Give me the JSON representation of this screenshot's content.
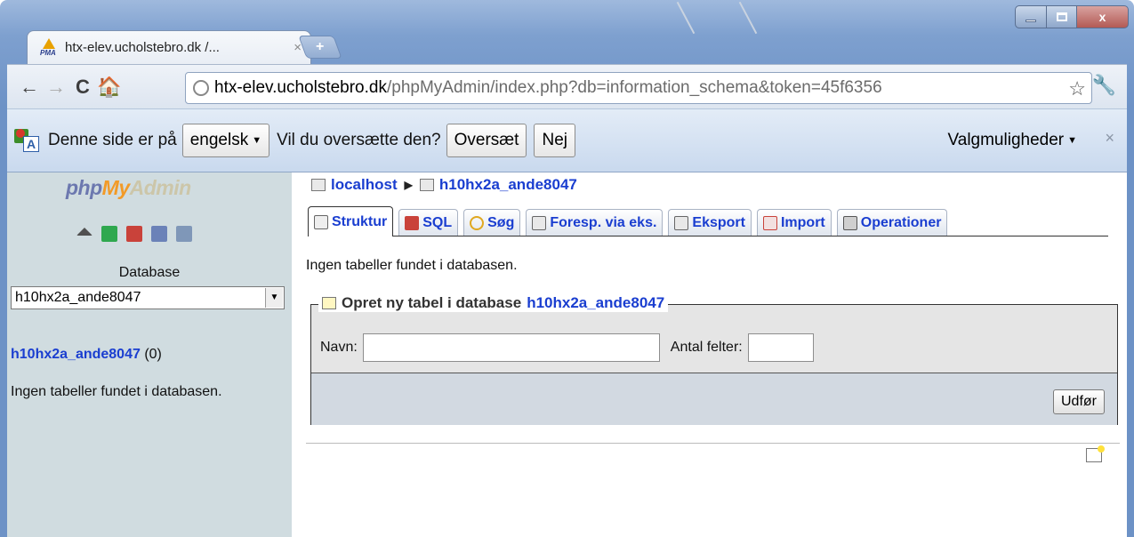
{
  "browser": {
    "tab_title": "htx-elev.ucholstebro.dk /...",
    "tab_close": "×",
    "new_tab": "+",
    "win_close": "x",
    "nav": {
      "back": "←",
      "forward": "→",
      "reload": "C",
      "home": "🏠"
    },
    "url_host": "htx-elev.ucholstebro.dk",
    "url_rest": "/phpMyAdmin/index.php?db=information_schema&token=45f6356",
    "bookmark": "☆",
    "menu": "🔧"
  },
  "translate_bar": {
    "prefix": "Denne side er på",
    "language": "engelsk",
    "question": "Vil du oversætte den?",
    "translate_button": "Oversæt",
    "no_button": "Nej",
    "options": "Valgmuligheder",
    "close": "×"
  },
  "sidebar": {
    "logo_php": "php",
    "logo_my": "My",
    "logo_admin": "Admin",
    "db_label": "Database",
    "db_selected": "h10hx2a_ande8047",
    "db_link": "h10hx2a_ande8047",
    "db_count": "(0)",
    "message": "Ingen tabeller fundet i databasen."
  },
  "main": {
    "breadcrumb_server": "localhost",
    "breadcrumb_db": "h10hx2a_ande8047",
    "tabs": [
      {
        "label": "Struktur"
      },
      {
        "label": "SQL"
      },
      {
        "label": "Søg"
      },
      {
        "label": "Foresp. via eks."
      },
      {
        "label": "Eksport"
      },
      {
        "label": "Import"
      },
      {
        "label": "Operationer"
      }
    ],
    "message": "Ingen tabeller fundet i databasen.",
    "create_legend": "Opret ny tabel i database",
    "create_db": "h10hx2a_ande8047",
    "name_label": "Navn:",
    "name_value": "",
    "fields_label": "Antal felter:",
    "fields_value": "",
    "go_button": "Udfør"
  },
  "colors": {
    "link": "#1a3ed0",
    "sidebar_bg": "#d0dce0",
    "logo_orange": "#f29a27",
    "logo_blue": "#6c78af"
  }
}
